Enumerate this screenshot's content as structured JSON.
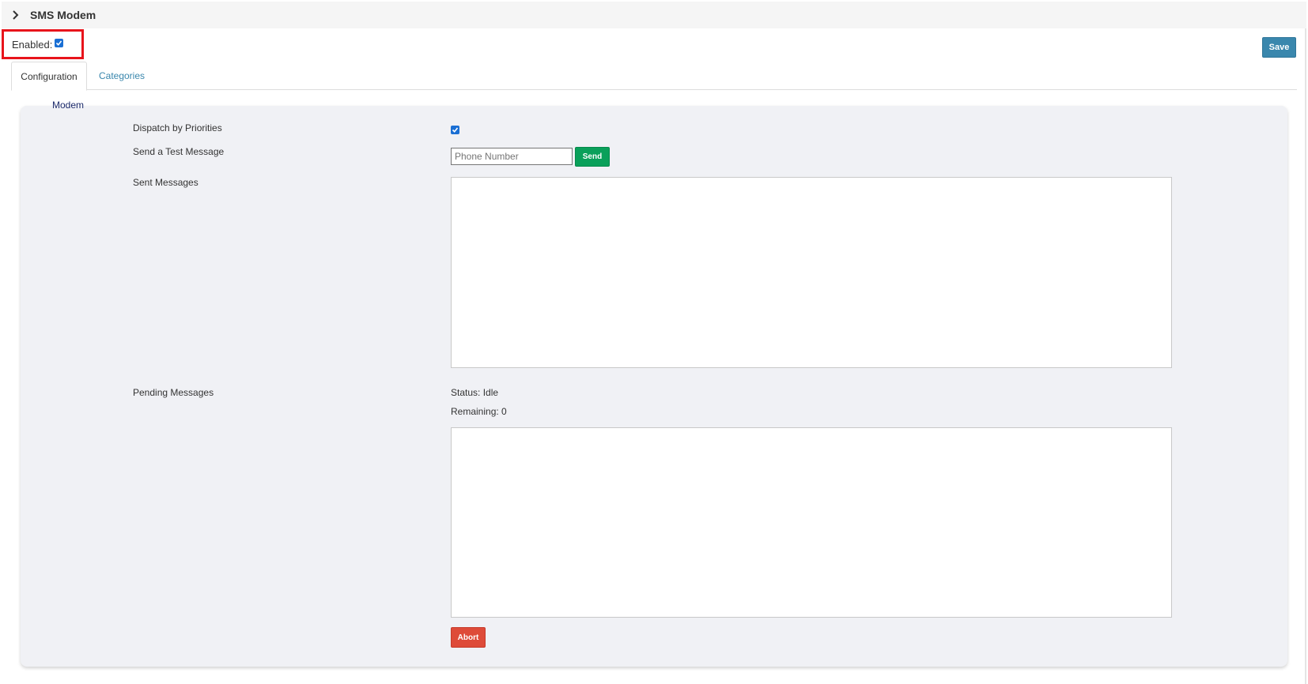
{
  "header": {
    "title": "SMS Modem",
    "expand_icon": "chevron-right-icon"
  },
  "enabled": {
    "label": "Enabled:",
    "checked": true
  },
  "toolbar": {
    "save_label": "Save"
  },
  "tabs": [
    {
      "label": "Configuration",
      "active": true
    },
    {
      "label": "Categories",
      "active": false
    }
  ],
  "section": {
    "legend": "Modem"
  },
  "form": {
    "dispatch_label": "Dispatch by Priorities",
    "dispatch_checked": true,
    "test_label": "Send a Test Message",
    "phone_placeholder": "Phone Number",
    "phone_value": "",
    "send_label": "Send",
    "sent_label": "Sent Messages",
    "sent_value": "",
    "pending_label": "Pending Messages",
    "status_text": "Status: Idle",
    "remaining_text": "Remaining: 0",
    "pending_value": "",
    "abort_label": "Abort"
  },
  "colors": {
    "save": "#3a87ad",
    "send": "#0aa05a",
    "abort": "#de4b39",
    "highlight": "#e8141b",
    "checkbox": "#1a6fd4"
  }
}
